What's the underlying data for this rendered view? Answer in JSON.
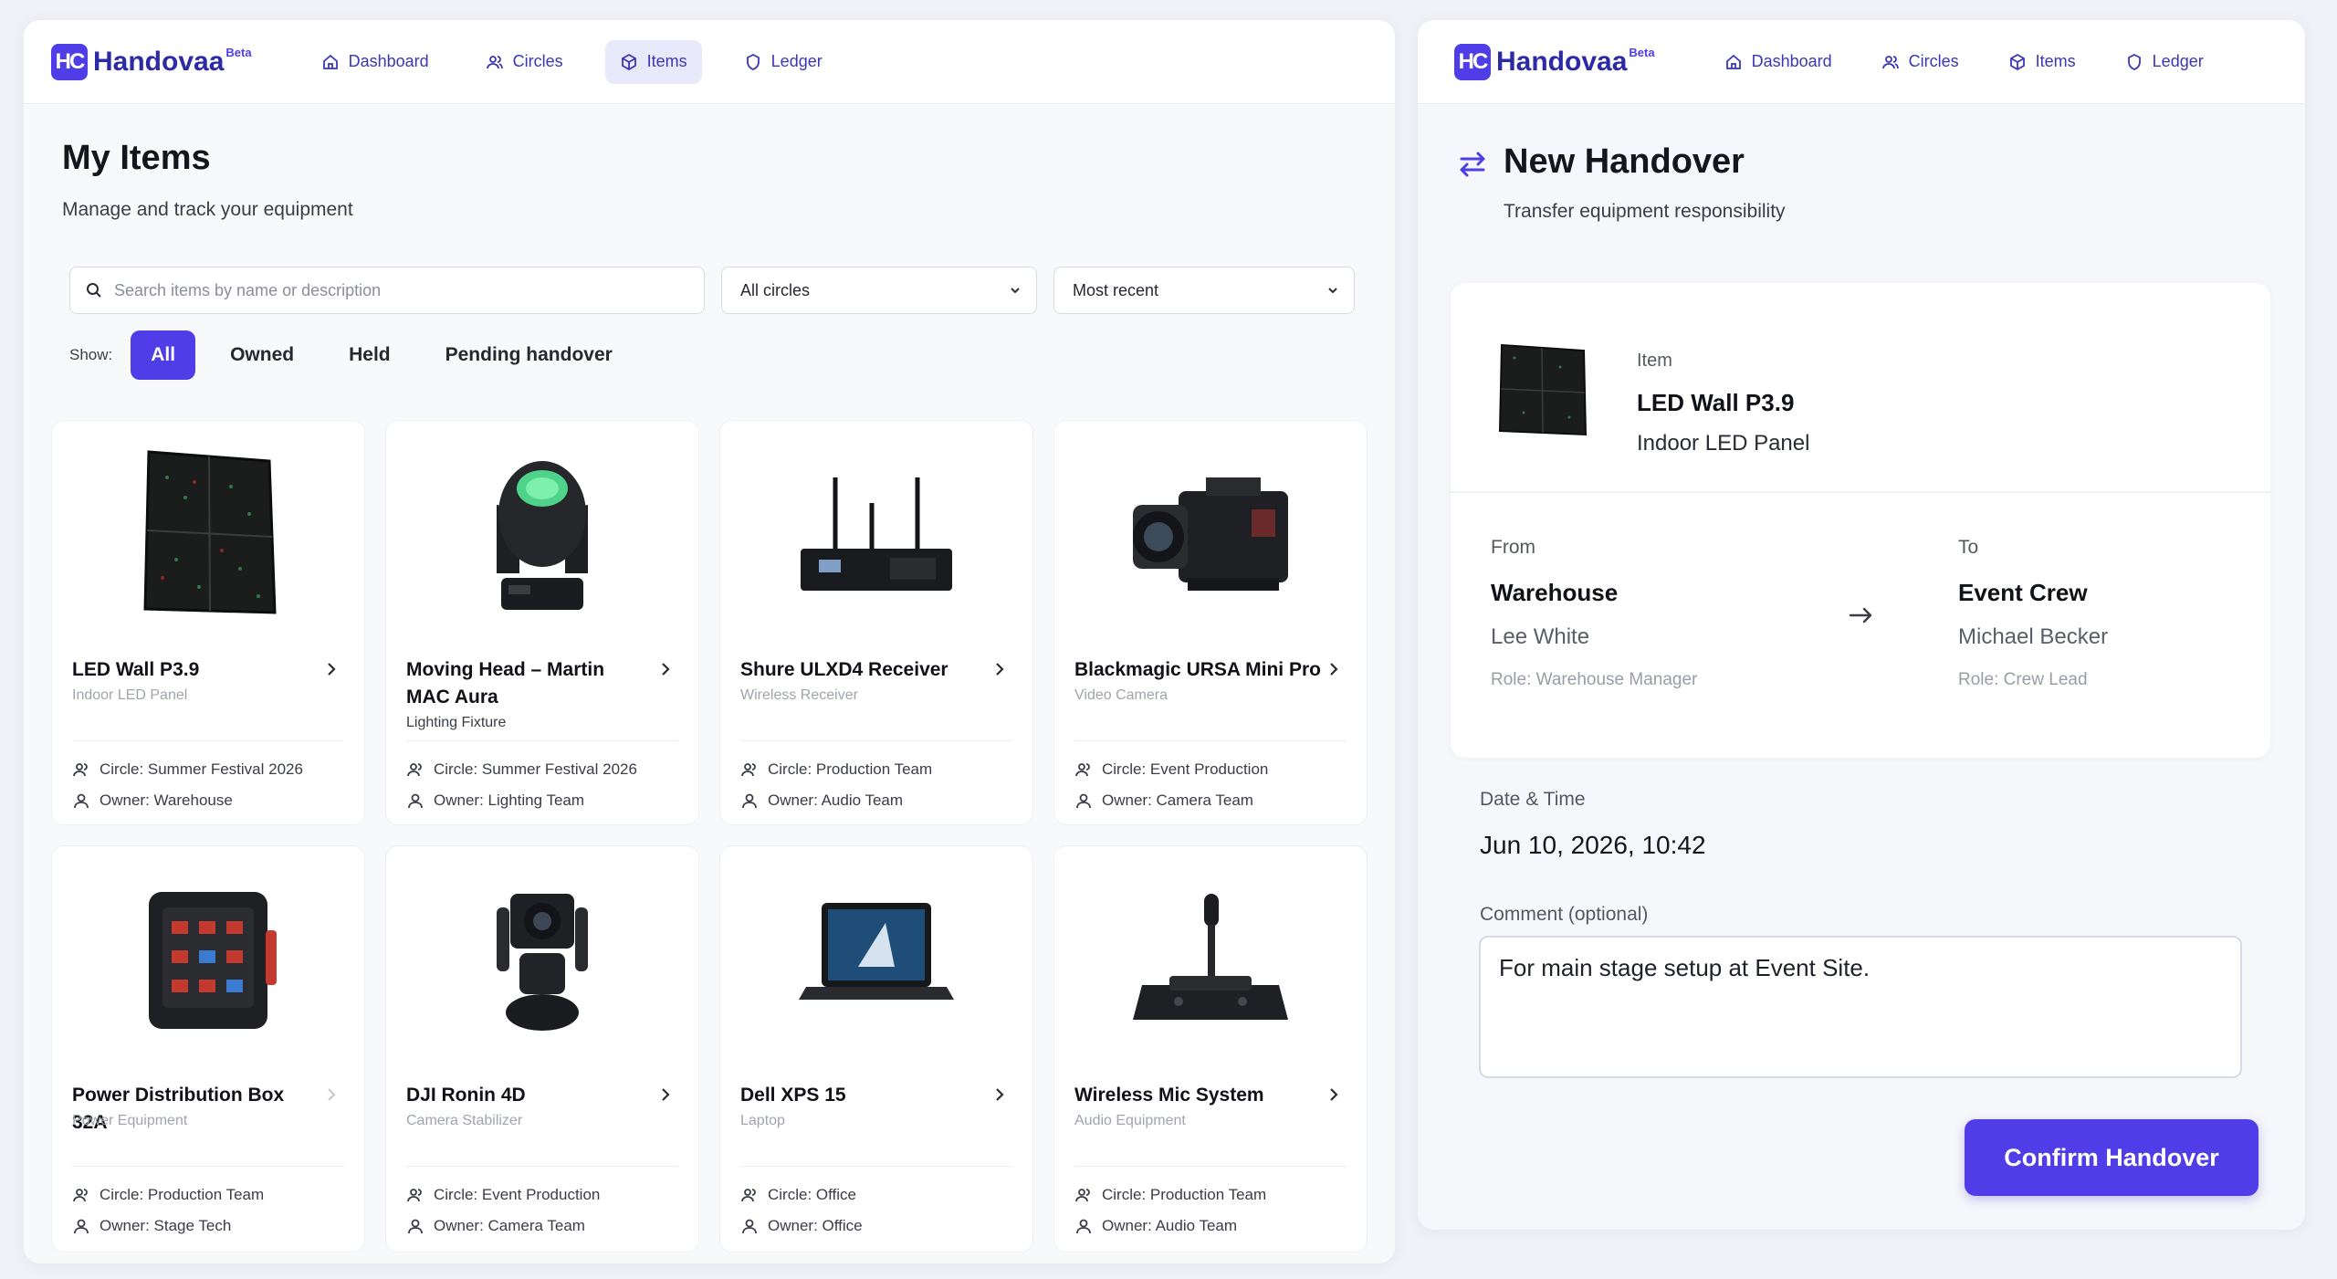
{
  "app": {
    "logo_mark": "HC",
    "name": "Handovaa",
    "badge": "Beta",
    "nav": [
      {
        "label": "Dashboard",
        "icon": "home-icon"
      },
      {
        "label": "Circles",
        "icon": "users-icon"
      },
      {
        "label": "Items",
        "icon": "box-icon"
      },
      {
        "label": "Ledger",
        "icon": "shield-icon"
      }
    ],
    "active_nav": "Items",
    "accent": "#4f3ee8"
  },
  "items_page": {
    "title": "My Items",
    "subtitle": "Manage and track your equipment",
    "search_placeholder": "Search items by name or description",
    "circle_filter": "All circles",
    "sort": "Most recent",
    "show_label": "Show:",
    "filters": [
      "All",
      "Owned",
      "Held",
      "Pending handover"
    ],
    "active_filter": "All",
    "items": [
      {
        "name": "LED Wall P3.9",
        "category": "Indoor LED Panel",
        "circle": "Circle: Summer Festival 2026",
        "owner": "Owner: Warehouse",
        "icon": "led-wall-icon"
      },
      {
        "name": "Moving Head – Martin MAC Aura",
        "category": "Lighting Fixture",
        "circle": "Circle: Summer Festival 2026",
        "owner": "Owner: Lighting Team",
        "icon": "moving-head-icon"
      },
      {
        "name": "Shure ULXD4 Receiver",
        "category": "Wireless Receiver",
        "circle": "Circle: Production Team",
        "owner": "Owner: Audio Team",
        "icon": "receiver-icon"
      },
      {
        "name": "Blackmagic URSA Mini Pro",
        "category": "Video Camera",
        "circle": "Circle: Event Production",
        "owner": "Owner: Camera Team",
        "icon": "camera-icon"
      },
      {
        "name": "Power Distribution Box 32A",
        "category": "Power Equipment",
        "circle": "Circle: Production Team",
        "owner": "Owner: Stage Tech",
        "icon": "power-box-icon"
      },
      {
        "name": "DJI Ronin 4D",
        "category": "Camera Stabilizer",
        "circle": "Circle: Event Production",
        "owner": "Owner: Camera Team",
        "icon": "gimbal-camera-icon"
      },
      {
        "name": "Dell XPS 15",
        "category": "Laptop",
        "circle": "Circle: Office",
        "owner": "Owner: Office",
        "icon": "laptop-icon"
      },
      {
        "name": "Wireless Mic System",
        "category": "Audio Equipment",
        "circle": "Circle: Production Team",
        "owner": "Owner: Audio Team",
        "icon": "mic-system-icon"
      }
    ]
  },
  "handover": {
    "title": "New Handover",
    "subtitle": "Transfer equipment responsibility",
    "item_label": "Item",
    "item_name": "LED Wall P3.9",
    "item_category": "Indoor LED Panel",
    "from_label": "From",
    "from_location": "Warehouse",
    "from_person": "Lee White",
    "from_role": "Role: Warehouse Manager",
    "to_label": "To",
    "to_location": "Event Crew",
    "to_person": "Michael Becker",
    "to_role": "Role: Crew Lead",
    "datetime_label": "Date & Time",
    "datetime_value": "Jun 10, 2026, 10:42",
    "comment_label": "Comment (optional)",
    "comment_value": "For main stage setup at Event Site.",
    "confirm_label": "Confirm Handover"
  }
}
